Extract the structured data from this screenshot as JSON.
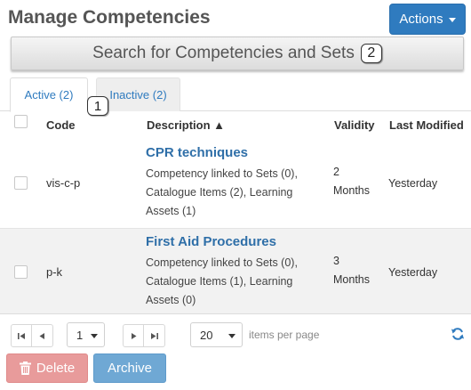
{
  "header": {
    "title": "Manage Competencies",
    "actions_label": "Actions"
  },
  "search_bar": {
    "label": "Search for Competencies and Sets",
    "badge": "2"
  },
  "tabs": [
    {
      "label": "Active (2)",
      "active": true
    },
    {
      "label": "Inactive (2)",
      "active": false
    }
  ],
  "tab_badge": "1",
  "table": {
    "columns": [
      "Code",
      "Description ▲",
      "Validity",
      "Last Modified"
    ],
    "rows": [
      {
        "code": "vis-c-p",
        "title": "CPR techniques",
        "desc_lines": [
          "Competency linked to Sets (0),",
          "Catalogue Items (2), Learning",
          "Assets (1)"
        ],
        "validity_lines": [
          "2",
          "Months"
        ],
        "last_modified": "Yesterday"
      },
      {
        "code": "p-k",
        "title": "First Aid Procedures",
        "desc_lines": [
          "Competency linked to Sets (0),",
          "Catalogue Items (1), Learning",
          "Assets (0)"
        ],
        "validity_lines": [
          "3",
          "Months"
        ],
        "last_modified": "Yesterday"
      }
    ]
  },
  "pager": {
    "first_icon": "first-page-icon",
    "prev_icon": "prev-page-icon",
    "next_icon": "next-page-icon",
    "last_icon": "last-page-icon",
    "page": "1",
    "page_size": "20",
    "items_per_page_label": "items per page",
    "refresh_icon": "refresh-icon"
  },
  "buttons": {
    "delete_label": "Delete",
    "archive_label": "Archive"
  },
  "colors": {
    "primary": "#2f7bbf",
    "link": "#2f6fa8",
    "danger_disabled": "#e89b9b",
    "archive": "#6fa8d4"
  }
}
